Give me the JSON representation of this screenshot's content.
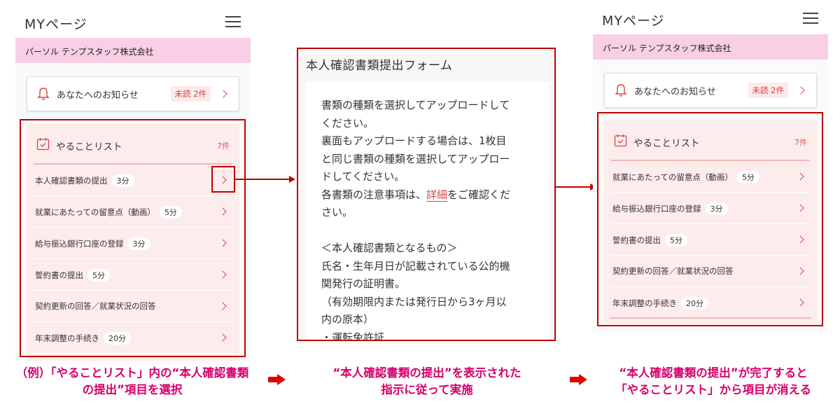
{
  "panel_before": {
    "title": "MYページ",
    "company": "パーソル テンプスタッフ株式会社",
    "notice": {
      "text": "あなたへのお知らせ",
      "badge": "未読 2件"
    },
    "todo": {
      "title": "やることリスト",
      "count": "7件",
      "items": [
        {
          "label": "本人確認書類の提出",
          "time": "3分"
        },
        {
          "label": "就業にあたっての留意点（動画）",
          "time": "5分"
        },
        {
          "label": "給与振込銀行口座の登録",
          "time": "3分"
        },
        {
          "label": "誓約書の提出",
          "time": "5分"
        },
        {
          "label": "契約更新の回答／就業状況の回答",
          "time": ""
        },
        {
          "label": "年末調整の手続き",
          "time": "20分"
        }
      ]
    }
  },
  "form": {
    "title": "本人確認書類提出フォーム",
    "line1": "書類の種類を選択してアップロードして",
    "line2": "ください。",
    "line3": "裏面もアップロードする場合は、1枚目",
    "line4": "と同じ書類の種類を選択してアップロー",
    "line5": "ドしてください。",
    "line6_pre": "各書類の注意事項は、",
    "line6_link": "詳細",
    "line6_post": "をご確認くだ",
    "line7": "さい。",
    "line8": "＜本人確認書類となるもの＞",
    "line9": "氏名・生年月日が記載されている公的機",
    "line10": "関発行の証明書。",
    "line11": "（有効期限内または発行日から3ヶ月以",
    "line12": "内の原本）",
    "line13": "・運転免許証"
  },
  "panel_after": {
    "title": "MYページ",
    "company": "パーソル テンプスタッフ株式会社",
    "notice": {
      "text": "あなたへのお知らせ",
      "badge": "未読 2件"
    },
    "todo": {
      "title": "やることリスト",
      "count": "7件",
      "items": [
        {
          "label": "就業にあたっての留意点（動画）",
          "time": "5分"
        },
        {
          "label": "給与振込銀行口座の登録",
          "time": "3分"
        },
        {
          "label": "誓約書の提出",
          "time": "5分"
        },
        {
          "label": "契約更新の回答／就業状況の回答",
          "time": ""
        },
        {
          "label": "年末調整の手続き",
          "time": "20分"
        }
      ]
    }
  },
  "captions": {
    "left_1": "（例）「やることリスト」内の“本人確認書類",
    "left_2": "の提出”項目を選択",
    "mid_1": "“本人確認書類の提出”を表示された",
    "mid_2": "指示に従って実施",
    "right_1": "“本人確認書類の提出”が完了すると",
    "right_2": "「やることリスト」から項目が消える"
  },
  "colors": {
    "accent": "#c00000",
    "caption": "#d6006b",
    "pink_band": "#f8cfe5",
    "todo_bg": "#fdecec"
  }
}
